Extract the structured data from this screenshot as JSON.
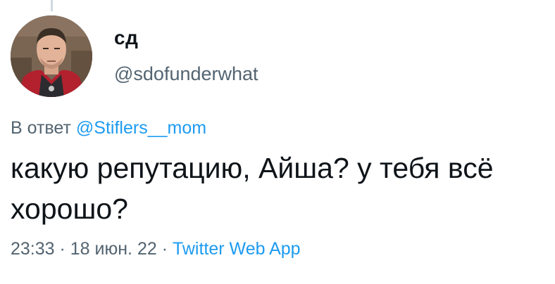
{
  "tweet": {
    "author": {
      "display_name": "сд",
      "handle": "@sdofunderwhat"
    },
    "reply": {
      "prefix": "В ответ",
      "mention": "@Stiflers__mom"
    },
    "text": "какую репутацию, Айша? у тебя всё хорошо?",
    "time": "23:33",
    "separator_1": " · ",
    "date": "18 июн. 22",
    "separator_2": " · ",
    "source": "Twitter Web App"
  },
  "colors": {
    "text_primary": "#0f1419",
    "text_secondary": "#536471",
    "accent": "#1d9bf0",
    "thread_line": "#cfd9de"
  },
  "icons": {
    "avatar": "user-photo"
  }
}
